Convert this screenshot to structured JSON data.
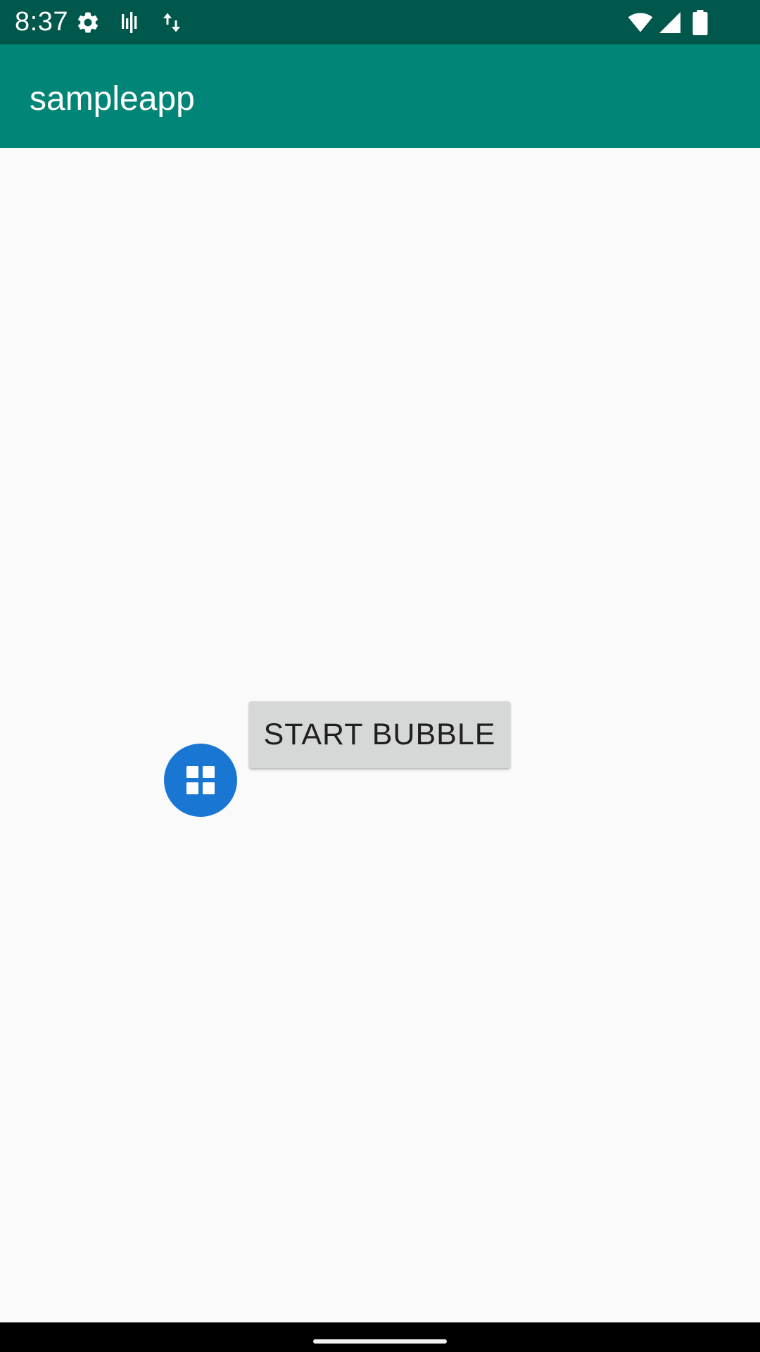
{
  "status_bar": {
    "time": "8:37",
    "icons_left": [
      "settings-icon",
      "signal-bars-icon",
      "data-transfer-icon"
    ],
    "icons_right": [
      "wifi-icon",
      "cell-signal-icon",
      "battery-icon"
    ],
    "background": "#00574b"
  },
  "app_bar": {
    "title": "sampleapp",
    "background": "#008577"
  },
  "main": {
    "start_button_label": "START BUBBLE",
    "bubble_icon": "grid-icon",
    "bubble_color": "#1976d2"
  },
  "nav_bar": {
    "home_handle": "home-handle"
  }
}
